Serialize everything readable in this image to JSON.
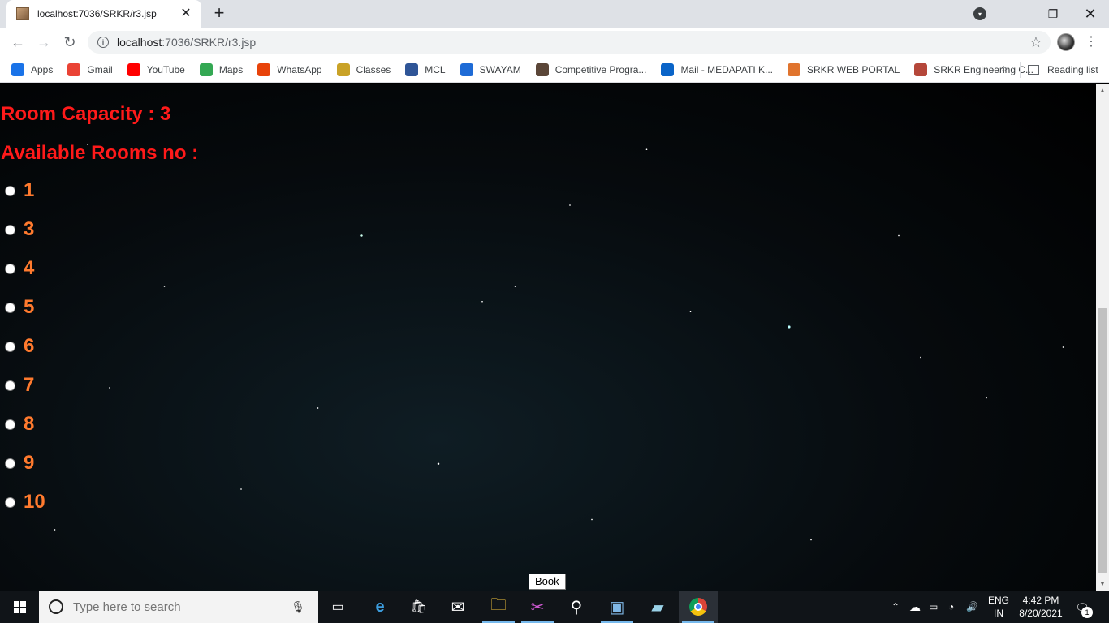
{
  "browser": {
    "tab_title": "localhost:7036/SRKR/r3.jsp",
    "url_host": "localhost",
    "url_rest": ":7036/SRKR/r3.jsp",
    "bookmarks": [
      {
        "label": "Apps",
        "icon": "apps-grid-icon",
        "color": "#1a73e8"
      },
      {
        "label": "Gmail",
        "icon": "gmail-icon",
        "color": "#ea4335"
      },
      {
        "label": "YouTube",
        "icon": "youtube-icon",
        "color": "#ff0000"
      },
      {
        "label": "Maps",
        "icon": "maps-pin-icon",
        "color": "#34a853"
      },
      {
        "label": "WhatsApp",
        "icon": "whatsapp-icon",
        "color": "#e8430a"
      },
      {
        "label": "Classes",
        "icon": "classroom-icon",
        "color": "#c9a227"
      },
      {
        "label": "MCL",
        "icon": "mcl-icon",
        "color": "#2f5597"
      },
      {
        "label": "SWAYAM",
        "icon": "swayam-icon",
        "color": "#1e6bd6"
      },
      {
        "label": "Competitive Progra...",
        "icon": "codechef-icon",
        "color": "#5b4638"
      },
      {
        "label": "Mail - MEDAPATI K...",
        "icon": "outlook-icon",
        "color": "#0a64c8"
      },
      {
        "label": "SRKR WEB PORTAL",
        "icon": "srkr-portal-icon",
        "color": "#e0742e"
      },
      {
        "label": "SRKR Engineering C...",
        "icon": "srkr-college-icon",
        "color": "#b5473a"
      }
    ],
    "reading_list": "Reading list"
  },
  "page": {
    "room_capacity": "Room Capacity : 3",
    "available_rooms": "Available Rooms no :",
    "rooms": [
      "1",
      "3",
      "4",
      "5",
      "6",
      "7",
      "8",
      "9",
      "10"
    ],
    "tooltip": "Book",
    "heading_color": "#ff1a1a",
    "room_color": "#ff7a2e"
  },
  "taskbar": {
    "search_placeholder": "Type here to search",
    "lang_line1": "ENG",
    "lang_line2": "IN",
    "time": "4:42 PM",
    "date": "8/20/2021",
    "notification_count": "1"
  }
}
